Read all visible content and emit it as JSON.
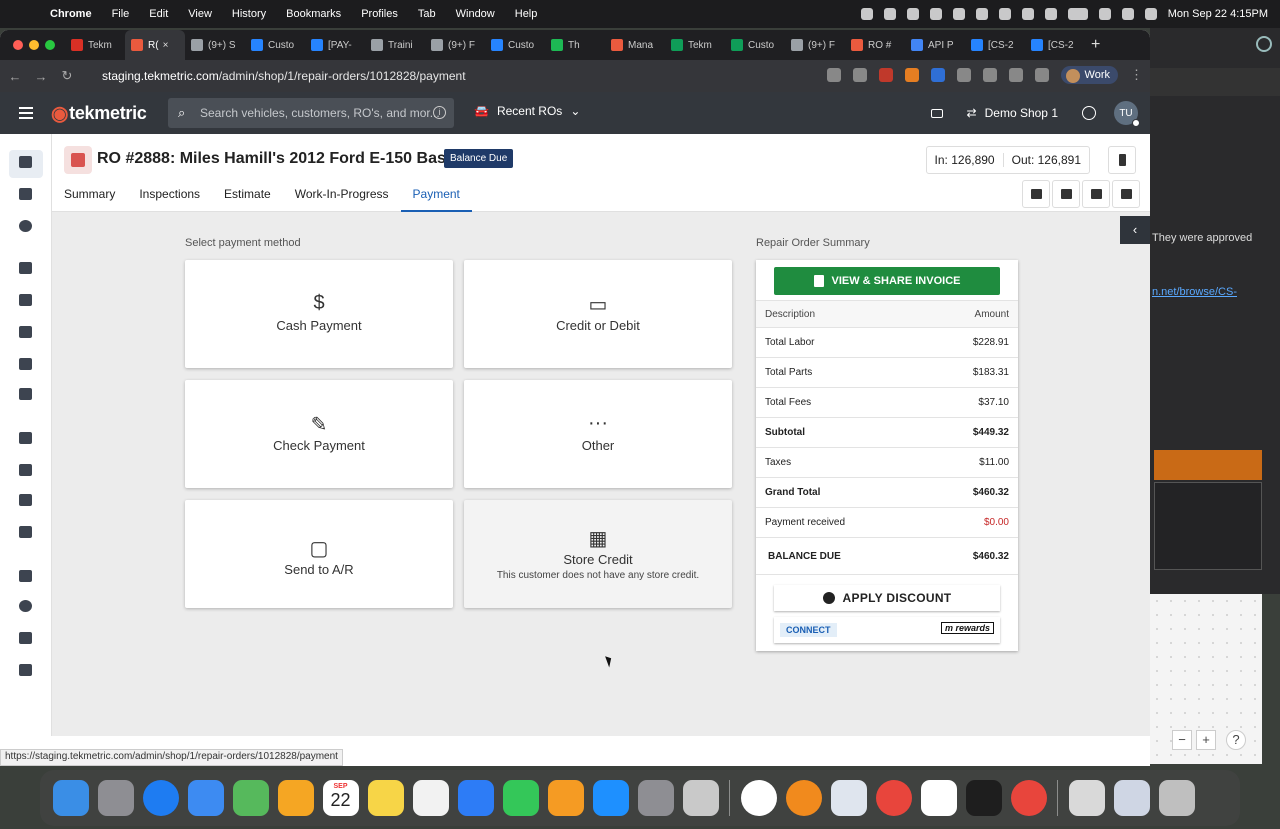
{
  "menubar": {
    "app": "Chrome",
    "items": [
      "File",
      "Edit",
      "View",
      "History",
      "Bookmarks",
      "Profiles",
      "Tab",
      "Window",
      "Help"
    ],
    "clock": "Mon Sep 22  4:15PM"
  },
  "browser": {
    "tabs": [
      {
        "label": "Tekm",
        "color": "#d93025"
      },
      {
        "label": "R(",
        "color": "#ea5a3e",
        "active": true
      },
      {
        "label": "(9+) S",
        "color": "#9aa0a6"
      },
      {
        "label": "Custo",
        "color": "#2684ff"
      },
      {
        "label": "[PAY-",
        "color": "#2684ff"
      },
      {
        "label": "Traini",
        "color": "#9aa0a6"
      },
      {
        "label": "(9+) F",
        "color": "#9aa0a6"
      },
      {
        "label": "Custo",
        "color": "#2684ff"
      },
      {
        "label": "Th",
        "color": "#1db954"
      },
      {
        "label": "Mana",
        "color": "#ea5a3e"
      },
      {
        "label": "Tekm",
        "color": "#0f9d58"
      },
      {
        "label": "Custo",
        "color": "#0f9d58"
      },
      {
        "label": "(9+) F",
        "color": "#9aa0a6"
      },
      {
        "label": "RO #",
        "color": "#ea5a3e"
      },
      {
        "label": "API P",
        "color": "#4285f4"
      },
      {
        "label": "[CS-2",
        "color": "#2684ff"
      },
      {
        "label": "[CS-2",
        "color": "#2684ff"
      }
    ],
    "url_domain": "staging.tekmetric.com",
    "url_path": "/admin/shop/1/repair-orders/1012828/payment",
    "profile": "Work",
    "status_url": "https://staging.tekmetric.com/admin/shop/1/repair-orders/1012828/payment"
  },
  "app_header": {
    "logo_text": "tekmetric",
    "search_placeholder": "Search vehicles, customers, RO's, and mor...",
    "recent": "Recent ROs",
    "shop": "Demo Shop 1",
    "avatar": "TU"
  },
  "ro": {
    "title": "RO #2888: Miles Hamill's 2012 Ford E-150 Base",
    "badge": "Balance Due",
    "mileage_in": "In: 126,890",
    "mileage_out": "Out: 126,891",
    "tabs": [
      "Summary",
      "Inspections",
      "Estimate",
      "Work-In-Progress",
      "Payment"
    ],
    "active_tab": "Payment"
  },
  "payment": {
    "section_label": "Select payment method",
    "methods": [
      {
        "icon": "$",
        "label": "Cash Payment"
      },
      {
        "icon": "▭",
        "label": "Credit or Debit"
      },
      {
        "icon": "✎",
        "label": "Check Payment"
      },
      {
        "icon": "···",
        "label": "Other"
      },
      {
        "icon": "▢",
        "label": "Send to A/R"
      },
      {
        "icon": "▦",
        "label": "Store Credit",
        "sub": "This customer does not have any store credit."
      }
    ]
  },
  "summary": {
    "section_label": "Repair Order Summary",
    "invoice_button": "VIEW & SHARE INVOICE",
    "col_description": "Description",
    "col_amount": "Amount",
    "rows": [
      {
        "label": "Total Labor",
        "value": "$228.91"
      },
      {
        "label": "Total Parts",
        "value": "$183.31"
      },
      {
        "label": "Total Fees",
        "value": "$37.10"
      },
      {
        "label": "Subtotal",
        "value": "$449.32",
        "bold": true
      },
      {
        "label": "Taxes",
        "value": "$11.00"
      },
      {
        "label": "Grand Total",
        "value": "$460.32",
        "bold": true
      },
      {
        "label": "Payment received",
        "value": "$0.00",
        "red": true
      }
    ],
    "balance_label": "BALANCE DUE",
    "balance_value": "$460.32",
    "discount_button": "APPLY DISCOUNT",
    "connect_button": "CONNECT",
    "rewards_logo": "m rewards"
  },
  "background_app": {
    "text": "They were approved",
    "link": "n.net/browse/CS-"
  },
  "dock": {
    "calendar_month": "SEP",
    "calendar_day": "22",
    "apps": [
      "Finder",
      "Launchpad",
      "Safari",
      "Mail",
      "Maps",
      "Photos",
      "Calendar",
      "Notes",
      "News",
      "Keynote",
      "Numbers",
      "Pages",
      "App Store",
      "System Settings",
      "iPhone Mirroring",
      "Compass",
      "Lastpass",
      "Preview",
      "Chrome",
      "Slack",
      "Figma",
      "Chrome Canary",
      "Screenshot",
      "Preview",
      "Trash"
    ]
  }
}
